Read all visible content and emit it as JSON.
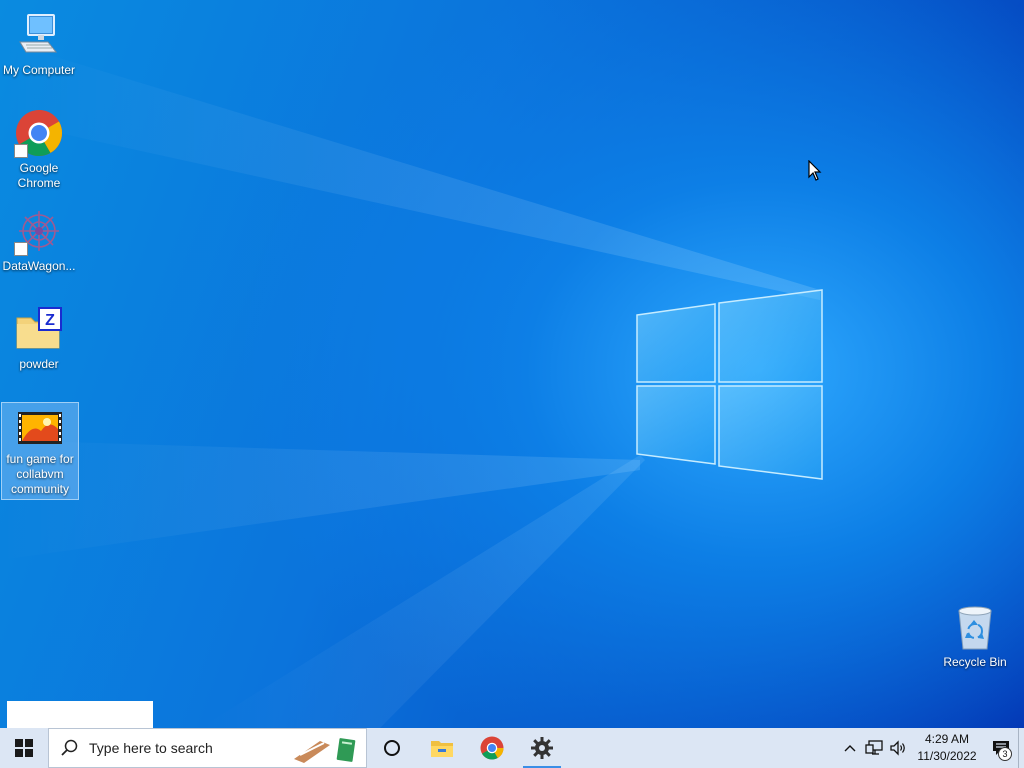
{
  "desktop": {
    "icons": [
      {
        "label": "My Computer",
        "icon": "computer-icon"
      },
      {
        "label": "Google Chrome",
        "icon": "chrome-icon"
      },
      {
        "label": "DataWagon...",
        "icon": "datawagon-icon"
      },
      {
        "label": "powder",
        "icon": "powder-folder-icon"
      },
      {
        "label": "fun game for collabvm community",
        "icon": "video-file-icon"
      }
    ],
    "recycle_bin": {
      "label": "Recycle Bin",
      "icon": "recycle-bin-icon"
    }
  },
  "taskbar": {
    "search_placeholder": "Type here to search",
    "apps": [
      {
        "name": "cortana",
        "icon": "cortana-icon"
      },
      {
        "name": "file-explorer",
        "icon": "folder-icon"
      },
      {
        "name": "chrome",
        "icon": "chrome-icon"
      },
      {
        "name": "settings",
        "icon": "gear-icon",
        "active": true
      }
    ],
    "clock": {
      "time": "4:29 AM",
      "date": "11/30/2022"
    },
    "notification_count": "3"
  },
  "colors": {
    "taskbar_bg": "#dce6f4",
    "desktop_accent": "#0b74dc",
    "selection": "#b4d7ff"
  }
}
